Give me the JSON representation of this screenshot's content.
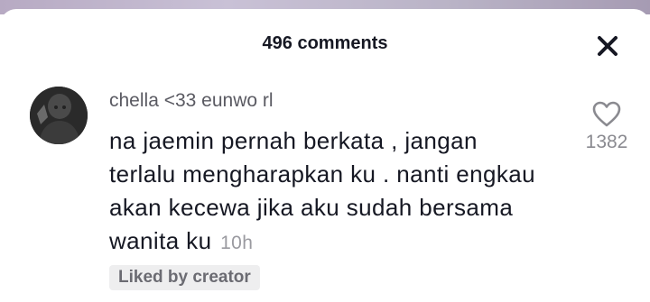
{
  "header": {
    "title": "496 comments",
    "close_icon": "close-icon"
  },
  "comment": {
    "username": "chella <33 eunwo rl",
    "text": "na jaemin pernah berkata , jangan terlalu mengharapkan ku . nanti engkau akan kecewa jika aku sudah bersama wanita ku",
    "time": "10h",
    "likes": "1382",
    "like_icon": "heart-outline-icon",
    "badge": "Liked by creator"
  },
  "colors": {
    "text_primary": "#161823",
    "text_secondary": "#5a5a62",
    "muted": "#9a9aa0",
    "badge_bg": "#eeeeef"
  }
}
